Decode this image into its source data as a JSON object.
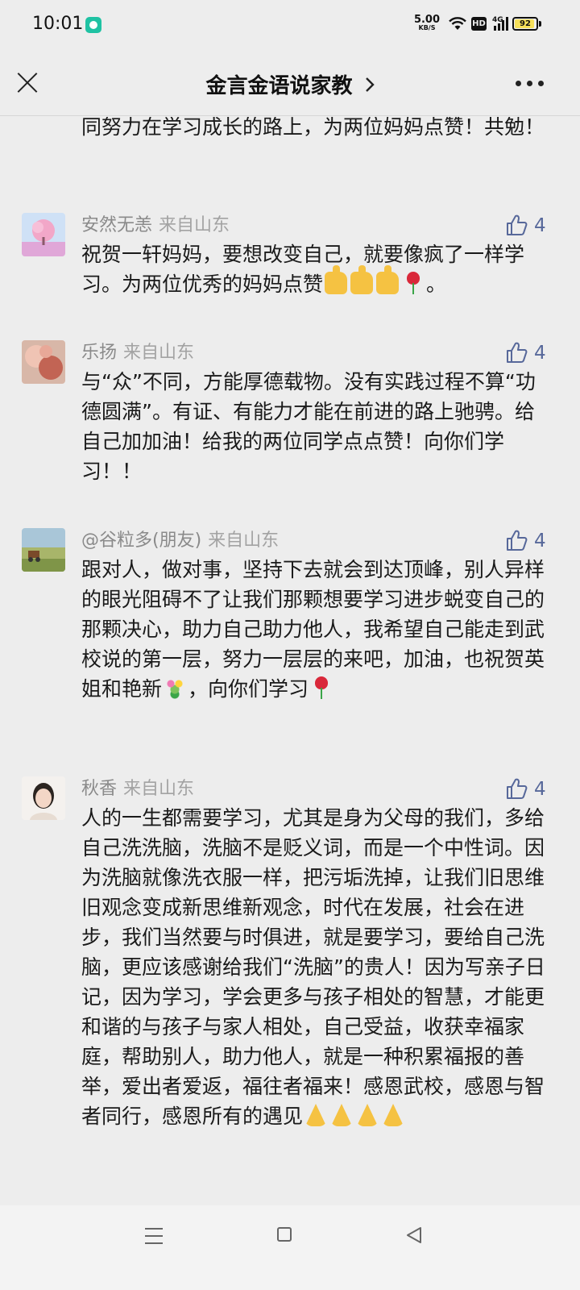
{
  "status_bar": {
    "time": "10:01",
    "net_speed_value": "5.00",
    "net_speed_unit": "KB/S",
    "hd_label": "HD",
    "signal_label": "4G",
    "battery_level": 92,
    "battery_label": "92"
  },
  "navbar": {
    "title": "金言金语说家教"
  },
  "top_partial_text": "同努力在学习成长的路上，为两位妈妈点赞！共勉！",
  "comments": [
    {
      "name": "安然无恙",
      "location": "来自山东",
      "likes": "4",
      "text_a": "祝贺一轩妈妈，要想改变自己，就要像疯了一样学习。为两位优秀的妈妈点赞",
      "text_b": "。"
    },
    {
      "name": "乐扬",
      "location": "来自山东",
      "likes": "4",
      "text": "与“众”不同，方能厚德载物。没有实践过程不算“功德圆满”。有证、有能力才能在前进的路上驰骋。给自己加加油！给我的两位同学点点赞！向你们学习！！"
    },
    {
      "name": "@谷粒多(朋友)",
      "location": "来自山东",
      "likes": "4",
      "text_a": "跟对人，做对事，坚持下去就会到达顶峰，别人异样的眼光阻碍不了让我们那颗想要学习进步蜕变自己的那颗决心，助力自己助力他人，我希望自己能走到武校说的第一层，努力一层层的来吧，加油，也祝贺英姐和艳新",
      "text_b": "，向你们学习"
    },
    {
      "name": "秋香",
      "location": "来自山东",
      "likes": "4",
      "text": "人的一生都需要学习，尤其是身为父母的我们，多给自己洗洗脑，洗脑不是贬义词，而是一个中性词。因为洗脑就像洗衣服一样，把污垢洗掉，让我们旧思维旧观念变成新思维新观念，时代在发展，社会在进步，我们当然要与时俱进，就是要学习，要给自己洗脑，更应该感谢给我们“洗脑”的贵人！因为写亲子日记，因为学习，学会更多与孩子相处的智慧，才能更和谐的与孩子与家人相处，自己受益，收获幸福家庭，帮助别人，助力他人，就是一种积累福报的善举，爱出者爱返，福往者福来！感恩武校，感恩与智者同行，感恩所有的遇见"
    }
  ],
  "icons": {
    "close": "close-icon",
    "chevron": "chevron-right-icon",
    "more": "more-icon",
    "like": "thumbs-up-icon",
    "emoji_thumb": "thumbs-up-emoji",
    "emoji_rose": "rose-emoji",
    "emoji_bouquet": "bouquet-emoji",
    "emoji_pray": "folded-hands-emoji",
    "nav_menu": "menu-icon",
    "nav_home": "home-icon",
    "nav_back": "back-icon"
  },
  "colors": {
    "background": "#ededed",
    "like_count": "#57689a",
    "meta_text": "#8a8a8a"
  }
}
